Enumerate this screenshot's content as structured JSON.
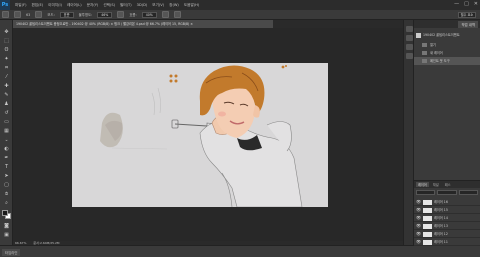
{
  "menubar": {
    "logo": "Ps",
    "items": [
      "파일(F)",
      "편집(E)",
      "이미지(I)",
      "레이어(L)",
      "문자(Y)",
      "선택(S)",
      "필터(T)",
      "3D(D)",
      "보기(V)",
      "창(W)",
      "도움말(H)"
    ],
    "window_controls": [
      "—",
      "□",
      "✕"
    ]
  },
  "options": {
    "size": "63",
    "mode_label": "모드:",
    "mode_value": "표준",
    "opacity_label": "불투명도:",
    "opacity_value": "46%",
    "flow_label": "흐름:",
    "flow_value": "40%",
    "workspace": "필수 요소"
  },
  "document": {
    "tab_title": "190402 꿀팁리스트이벤트 증정으로만 - 190402 @ 40% (RGB/8) × 핑크 / 빨강리본 4.psd @ 66.7% (레이어 15, RGB/8) ×"
  },
  "status": {
    "zoom": "66.67%",
    "doc_info": "문서:2.64M/25.2M"
  },
  "bottom": {
    "timeline_tab": "타임라인"
  },
  "history": {
    "tab": "작업 내역",
    "doc_name": "190402 꿀팁리스트이벤트",
    "items": [
      "열기",
      "새 레이어",
      "페인트 붓 도구"
    ]
  },
  "layers": {
    "tabs": [
      "레이어",
      "채널",
      "패스"
    ],
    "rows": [
      "레이어 16",
      "레이어 15",
      "레이어 14",
      "레이어 13",
      "레이어 12",
      "레이어 11"
    ]
  },
  "colors": {
    "accent": "#31a8ff",
    "canvas_bg": "#d8d7d8",
    "hair": "#c27a2c"
  }
}
